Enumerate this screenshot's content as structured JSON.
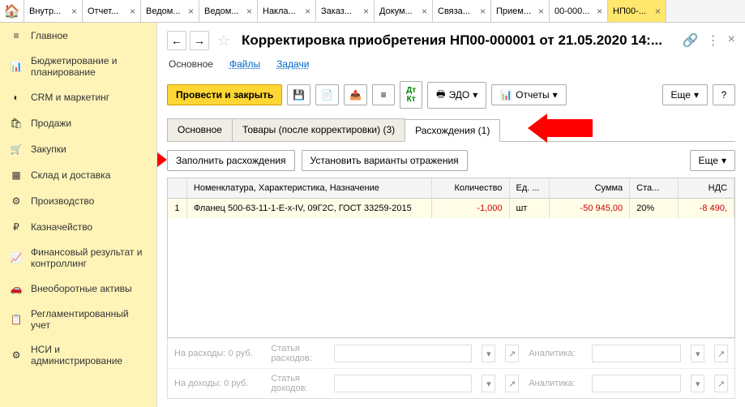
{
  "tabs": [
    "Внутр...",
    "Отчет...",
    "Ведом...",
    "Ведом...",
    "Накла...",
    "Заказ...",
    "Докум...",
    "Связа...",
    "Прием...",
    "00-000...",
    "НП00-..."
  ],
  "sidebar": [
    {
      "icon": "≡",
      "label": "Главное"
    },
    {
      "icon": "📊",
      "label": "Бюджетирование и планирование"
    },
    {
      "icon": "◐",
      "label": "CRM и маркетинг"
    },
    {
      "icon": "🛍",
      "label": "Продажи"
    },
    {
      "icon": "🛒",
      "label": "Закупки"
    },
    {
      "icon": "▦",
      "label": "Склад и доставка"
    },
    {
      "icon": "⚙",
      "label": "Производство"
    },
    {
      "icon": "₽",
      "label": "Казначейство"
    },
    {
      "icon": "📈",
      "label": "Финансовый результат и контроллинг"
    },
    {
      "icon": "🚗",
      "label": "Внеоборотные активы"
    },
    {
      "icon": "📋",
      "label": "Регламентированный учет"
    },
    {
      "icon": "⚙",
      "label": "НСИ и администрирование"
    }
  ],
  "title": "Корректировка приобретения НП00-000001 от 21.05.2020 14:...",
  "subnav": {
    "main": "Основное",
    "files": "Файлы",
    "tasks": "Задачи"
  },
  "toolbar": {
    "run": "Провести и закрыть",
    "edo": "ЭДО",
    "reports": "Отчеты",
    "more": "Еще",
    "help": "?"
  },
  "rowtabs": {
    "main": "Основное",
    "goods": "Товары (после корректировки) (3)",
    "diff": "Расхождения (1)"
  },
  "actions": {
    "fill": "Заполнить расхождения",
    "set": "Установить варианты отражения",
    "more": "Еще"
  },
  "cols": {
    "nom": "Номенклатура, Характеристика, Назначение",
    "qty": "Количество",
    "ed": "Ед. ...",
    "sum": "Сумма",
    "sta": "Ста...",
    "nds": "НДС"
  },
  "row1": {
    "n": "1",
    "nom": "Фланец 500-63-11-1-Е-х-IV, 09Г2С, ГОСТ 33259-2015",
    "qty": "-1,000",
    "ed": "шт",
    "sum": "-50 945,00",
    "sta": "20%",
    "nds": "-8 490,"
  },
  "footer": {
    "exp": "На расходы: 0 руб.",
    "inc": "На доходы: 0 руб.",
    "art": "Статья расходов:",
    "art2": "Статья доходов:",
    "ana": "Аналитика:"
  }
}
